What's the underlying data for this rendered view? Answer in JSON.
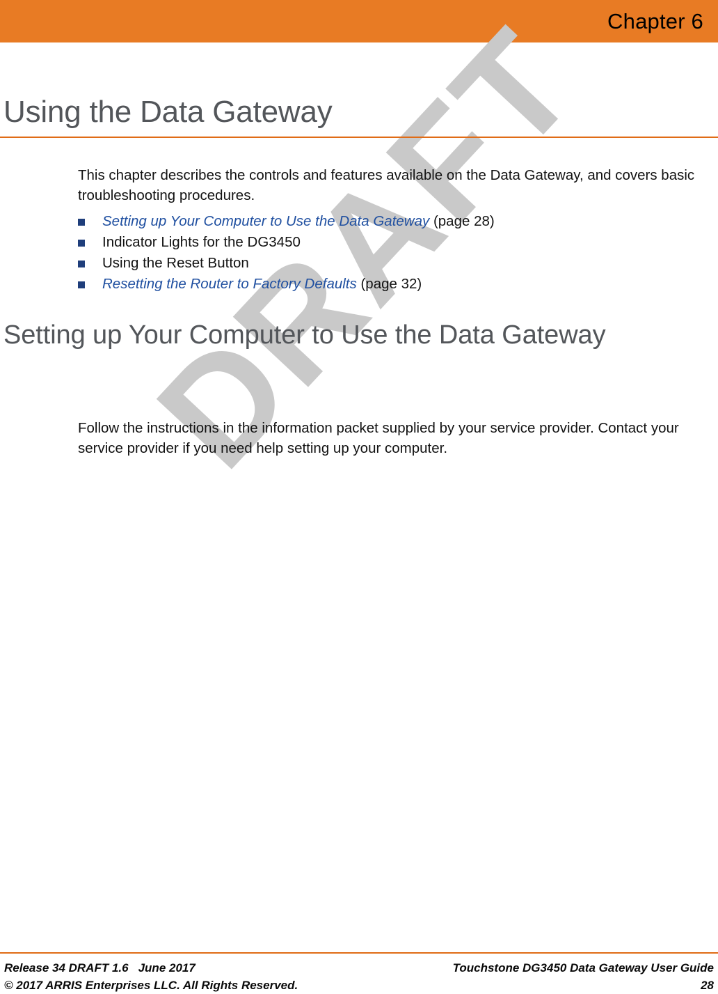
{
  "header": {
    "chapter_label": "Chapter 6",
    "banner_color": "#E87B24"
  },
  "watermark": {
    "text": "DRAFT",
    "color": "#C9C9C9"
  },
  "title": {
    "h1": "Using the Data Gateway",
    "rule_color": "#E06C16",
    "color": "#53565A"
  },
  "intro": {
    "paragraph": "This chapter describes the controls and features available on the Data Gateway, and covers basic troubleshooting procedures."
  },
  "toc": {
    "bullet_color": "#1F3E7B",
    "link_color": "#1F4FA0",
    "items": [
      {
        "link_text": "Setting up Your Computer to Use the Data Gateway",
        "plain_text": "",
        "suffix": " (page 28)",
        "is_link": true
      },
      {
        "link_text": "",
        "plain_text": "Indicator Lights for the DG3450",
        "suffix": "",
        "is_link": false
      },
      {
        "link_text": "",
        "plain_text": "Using the Reset Button",
        "suffix": "",
        "is_link": false
      },
      {
        "link_text": "Resetting the Router to Factory Defaults",
        "plain_text": "",
        "suffix": " (page 32)",
        "is_link": true
      }
    ]
  },
  "section": {
    "h2": "Setting up Your Computer to Use the Data Gateway",
    "paragraph": "Follow the instructions in the information packet supplied by your service provider. Contact your service provider if you need help setting up your computer."
  },
  "footer": {
    "rule_color": "#E06C16",
    "release": "Release 34 DRAFT 1.6",
    "date": "June 2017",
    "copyright": "© 2017 ARRIS Enterprises LLC. All Rights Reserved.",
    "guide_title": "Touchstone DG3450 Data Gateway User Guide",
    "page_number": "28"
  }
}
